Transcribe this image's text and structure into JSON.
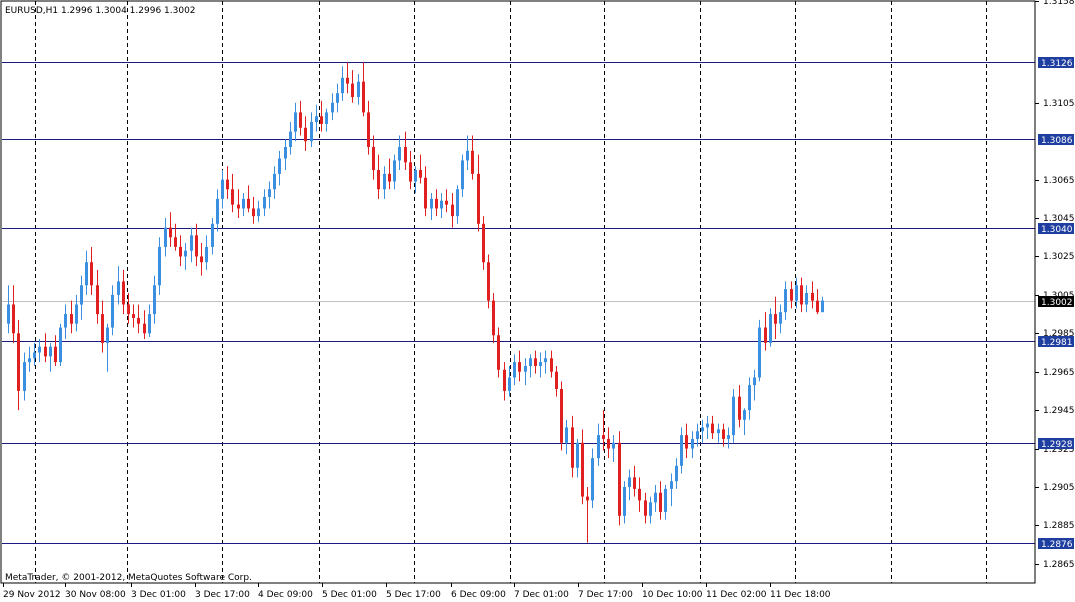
{
  "header_text": "EURUSD,H1  1.2996 1.3004 1.2996 1.3002",
  "footer_text": "MetaTrader, © 2001-2012, MetaQuotes Software Corp.",
  "colors": {
    "background": "#ffffff",
    "grid": "#000000",
    "bull_candle": "#3a8fe0",
    "bear_candle": "#e02020",
    "level_line": "#1a1a80",
    "level_label_bg": "#1f3fa0",
    "current_price_line": "#c0c0c0",
    "current_price_label_bg": "#000000"
  },
  "chart_data": {
    "type": "candlestick",
    "symbol": "EURUSD",
    "timeframe": "H1",
    "last_bar": {
      "open": 1.2996,
      "high": 1.3004,
      "low": 1.2996,
      "close": 1.3002
    },
    "ylim": [
      1.2855,
      1.3158
    ],
    "y_ticks": [
      "1.3158",
      "1.3105",
      "1.3065",
      "1.3045",
      "1.3025",
      "1.3005",
      "1.2985",
      "1.2965",
      "1.2945",
      "1.2925",
      "1.2905",
      "1.2885",
      "1.2865"
    ],
    "x_labels": [
      "29 Nov 2012",
      "30 Nov 08:00",
      "3 Dec 01:00",
      "3 Dec 17:00",
      "4 Dec 09:00",
      "5 Dec 01:00",
      "5 Dec 17:00",
      "6 Dec 09:00",
      "7 Dec 01:00",
      "7 Dec 17:00",
      "10 Dec 10:00",
      "11 Dec 02:00",
      "11 Dec 18:00"
    ],
    "vertical_separators": [
      "29 Nov 2012",
      "30 Nov 08:00",
      "3 Dec 01:00",
      "3 Dec 17:00",
      "4 Dec 09:00",
      "5 Dec 01:00",
      "5 Dec 17:00",
      "6 Dec 09:00",
      "7 Dec 01:00",
      "7 Dec 17:00",
      "10 Dec 10:00",
      "11 Dec 02:00",
      "11 Dec 18:00",
      "12 Dec 10:00"
    ],
    "levels": [
      "1.3126",
      "1.3086",
      "1.3040",
      "1.2981",
      "1.2928",
      "1.2876"
    ],
    "current_price": "1.3002",
    "candles": [
      [
        1.299,
        1.301,
        1.2985,
        1.3
      ],
      [
        1.3,
        1.301,
        1.298,
        1.2985
      ],
      [
        1.2985,
        1.2992,
        1.2945,
        1.2955
      ],
      [
        1.2955,
        1.2975,
        1.295,
        1.297
      ],
      [
        1.297,
        1.2978,
        1.2965,
        1.2972
      ],
      [
        1.2972,
        1.298,
        1.2968,
        1.2975
      ],
      [
        1.2975,
        1.2982,
        1.297,
        1.2978
      ],
      [
        1.2978,
        1.2985,
        1.297,
        1.2973
      ],
      [
        1.2973,
        1.298,
        1.2965,
        1.2978
      ],
      [
        1.2978,
        1.2984,
        1.2968,
        1.297
      ],
      [
        1.297,
        1.299,
        1.2968,
        1.2988
      ],
      [
        1.2988,
        1.3,
        1.2982,
        1.2995
      ],
      [
        1.2995,
        1.3002,
        1.2985,
        1.299
      ],
      [
        1.299,
        1.3005,
        1.2986,
        1.3
      ],
      [
        1.3,
        1.3015,
        1.2992,
        1.301
      ],
      [
        1.301,
        1.3028,
        1.3005,
        1.3022
      ],
      [
        1.3022,
        1.303,
        1.3005,
        1.301
      ],
      [
        1.301,
        1.3018,
        1.299,
        1.2995
      ],
      [
        1.2995,
        1.3002,
        1.2975,
        1.298
      ],
      [
        1.298,
        1.299,
        1.2965,
        1.2988
      ],
      [
        1.2988,
        1.301,
        1.2984,
        1.3005
      ],
      [
        1.3005,
        1.302,
        1.3,
        1.3012
      ],
      [
        1.3012,
        1.3018,
        1.2995,
        1.3
      ],
      [
        1.3,
        1.3006,
        1.299,
        1.2995
      ],
      [
        1.2995,
        1.3,
        1.2988,
        1.2993
      ],
      [
        1.2993,
        1.3,
        1.2985,
        1.299
      ],
      [
        1.299,
        1.2997,
        1.2982,
        1.2985
      ],
      [
        1.2985,
        1.3,
        1.2983,
        1.2995
      ],
      [
        1.2995,
        1.3015,
        1.299,
        1.301
      ],
      [
        1.301,
        1.3035,
        1.3005,
        1.303
      ],
      [
        1.303,
        1.3045,
        1.3025,
        1.304
      ],
      [
        1.304,
        1.3048,
        1.303,
        1.3035
      ],
      [
        1.3035,
        1.3042,
        1.3028,
        1.303
      ],
      [
        1.303,
        1.3036,
        1.302,
        1.3025
      ],
      [
        1.3025,
        1.3032,
        1.3018,
        1.3028
      ],
      [
        1.3028,
        1.304,
        1.3022,
        1.3036
      ],
      [
        1.3036,
        1.3042,
        1.302,
        1.3025
      ],
      [
        1.3025,
        1.3032,
        1.3015,
        1.3022
      ],
      [
        1.3022,
        1.3036,
        1.3018,
        1.303
      ],
      [
        1.303,
        1.3045,
        1.3026,
        1.3042
      ],
      [
        1.3042,
        1.306,
        1.3038,
        1.3055
      ],
      [
        1.3055,
        1.307,
        1.305,
        1.3065
      ],
      [
        1.3065,
        1.3072,
        1.3055,
        1.306
      ],
      [
        1.306,
        1.3068,
        1.3048,
        1.3052
      ],
      [
        1.3052,
        1.306,
        1.3045,
        1.305
      ],
      [
        1.305,
        1.3058,
        1.3046,
        1.3055
      ],
      [
        1.3055,
        1.3062,
        1.3048,
        1.305
      ],
      [
        1.305,
        1.3056,
        1.3042,
        1.3046
      ],
      [
        1.3046,
        1.3054,
        1.3043,
        1.305
      ],
      [
        1.305,
        1.306,
        1.3046,
        1.3056
      ],
      [
        1.3056,
        1.3064,
        1.305,
        1.306
      ],
      [
        1.306,
        1.3072,
        1.3055,
        1.3068
      ],
      [
        1.3068,
        1.308,
        1.3062,
        1.3076
      ],
      [
        1.3076,
        1.3086,
        1.307,
        1.3082
      ],
      [
        1.3082,
        1.3095,
        1.3078,
        1.309
      ],
      [
        1.309,
        1.3105,
        1.3085,
        1.31
      ],
      [
        1.31,
        1.3106,
        1.3088,
        1.3092
      ],
      [
        1.3092,
        1.3098,
        1.308,
        1.3085
      ],
      [
        1.3085,
        1.31,
        1.3082,
        1.3095
      ],
      [
        1.3095,
        1.3104,
        1.309,
        1.3098
      ],
      [
        1.3098,
        1.3106,
        1.309,
        1.3094
      ],
      [
        1.3094,
        1.3102,
        1.309,
        1.31
      ],
      [
        1.31,
        1.311,
        1.3096,
        1.3105
      ],
      [
        1.3105,
        1.3115,
        1.31,
        1.311
      ],
      [
        1.311,
        1.3124,
        1.3106,
        1.3118
      ],
      [
        1.3118,
        1.3126,
        1.311,
        1.3115
      ],
      [
        1.3115,
        1.3122,
        1.3105,
        1.3108
      ],
      [
        1.3108,
        1.312,
        1.3104,
        1.3116
      ],
      [
        1.3116,
        1.3126,
        1.3098,
        1.31
      ],
      [
        1.31,
        1.3106,
        1.3078,
        1.3082
      ],
      [
        1.3082,
        1.3088,
        1.3065,
        1.307
      ],
      [
        1.307,
        1.3078,
        1.3055,
        1.306
      ],
      [
        1.306,
        1.3072,
        1.3055,
        1.3068
      ],
      [
        1.3068,
        1.3076,
        1.306,
        1.3064
      ],
      [
        1.3064,
        1.3078,
        1.306,
        1.3075
      ],
      [
        1.3075,
        1.3088,
        1.307,
        1.3082
      ],
      [
        1.3082,
        1.309,
        1.307,
        1.3074
      ],
      [
        1.3074,
        1.308,
        1.306,
        1.3064
      ],
      [
        1.3064,
        1.3072,
        1.3058,
        1.307
      ],
      [
        1.307,
        1.3078,
        1.3063,
        1.3066
      ],
      [
        1.3066,
        1.3072,
        1.3046,
        1.305
      ],
      [
        1.305,
        1.3058,
        1.3044,
        1.3055
      ],
      [
        1.3055,
        1.306,
        1.3046,
        1.305
      ],
      [
        1.305,
        1.3058,
        1.3045,
        1.3054
      ],
      [
        1.3054,
        1.306,
        1.3048,
        1.3052
      ],
      [
        1.3052,
        1.3058,
        1.304,
        1.3046
      ],
      [
        1.3046,
        1.3062,
        1.3042,
        1.306
      ],
      [
        1.306,
        1.3078,
        1.3056,
        1.3075
      ],
      [
        1.3075,
        1.3088,
        1.307,
        1.308
      ],
      [
        1.308,
        1.3088,
        1.3065,
        1.3068
      ],
      [
        1.3068,
        1.3078,
        1.3038,
        1.3042
      ],
      [
        1.3042,
        1.3046,
        1.3018,
        1.3022
      ],
      [
        1.3022,
        1.3026,
        1.2998,
        1.3002
      ],
      [
        1.3002,
        1.3006,
        1.298,
        1.2984
      ],
      [
        1.2984,
        1.2988,
        1.2962,
        1.2966
      ],
      [
        1.2966,
        1.297,
        1.295,
        1.2955
      ],
      [
        1.2955,
        1.2968,
        1.2952,
        1.2962
      ],
      [
        1.2962,
        1.2974,
        1.2958,
        1.297
      ],
      [
        1.297,
        1.2976,
        1.296,
        1.2965
      ],
      [
        1.2965,
        1.2972,
        1.2958,
        1.2968
      ],
      [
        1.2968,
        1.2974,
        1.2962,
        1.2972
      ],
      [
        1.2972,
        1.2976,
        1.2964,
        1.2968
      ],
      [
        1.2968,
        1.2975,
        1.2962,
        1.297
      ],
      [
        1.297,
        1.2976,
        1.2964,
        1.2972
      ],
      [
        1.2972,
        1.2976,
        1.2962,
        1.2965
      ],
      [
        1.2965,
        1.2968,
        1.2952,
        1.2956
      ],
      [
        1.2956,
        1.296,
        1.2924,
        1.2928
      ],
      [
        1.2928,
        1.294,
        1.2922,
        1.2936
      ],
      [
        1.2936,
        1.2942,
        1.291,
        1.2915
      ],
      [
        1.2915,
        1.293,
        1.291,
        1.2928
      ],
      [
        1.2928,
        1.2935,
        1.2896,
        1.29
      ],
      [
        1.29,
        1.2905,
        1.2876,
        1.2898
      ],
      [
        1.2898,
        1.2925,
        1.2894,
        1.292
      ],
      [
        1.292,
        1.2938,
        1.2916,
        1.2932
      ],
      [
        1.2932,
        1.2945,
        1.2924,
        1.293
      ],
      [
        1.293,
        1.2936,
        1.292,
        1.2925
      ],
      [
        1.2925,
        1.2932,
        1.2918,
        1.2928
      ],
      [
        1.2928,
        1.2934,
        1.2885,
        1.289
      ],
      [
        1.289,
        1.2908,
        1.2886,
        1.2905
      ],
      [
        1.2905,
        1.2914,
        1.2898,
        1.291
      ],
      [
        1.291,
        1.2916,
        1.29,
        1.2904
      ],
      [
        1.2904,
        1.291,
        1.2892,
        1.2898
      ],
      [
        1.2898,
        1.2902,
        1.2886,
        1.289
      ],
      [
        1.289,
        1.29,
        1.2886,
        1.2897
      ],
      [
        1.2897,
        1.2906,
        1.2892,
        1.2902
      ],
      [
        1.2902,
        1.2908,
        1.2888,
        1.2892
      ],
      [
        1.2892,
        1.2906,
        1.2888,
        1.2904
      ],
      [
        1.2904,
        1.2912,
        1.2895,
        1.2908
      ],
      [
        1.2908,
        1.292,
        1.2904,
        1.2916
      ],
      [
        1.2916,
        1.2936,
        1.2912,
        1.2932
      ],
      [
        1.2932,
        1.2938,
        1.292,
        1.2925
      ],
      [
        1.2925,
        1.2934,
        1.292,
        1.293
      ],
      [
        1.293,
        1.2938,
        1.2926,
        1.2934
      ],
      [
        1.2934,
        1.294,
        1.2928,
        1.2936
      ],
      [
        1.2936,
        1.2942,
        1.293,
        1.2938
      ],
      [
        1.2938,
        1.2942,
        1.293,
        1.2933
      ],
      [
        1.2933,
        1.2938,
        1.2928,
        1.2935
      ],
      [
        1.2935,
        1.2938,
        1.2926,
        1.293
      ],
      [
        1.293,
        1.2936,
        1.2925,
        1.2932
      ],
      [
        1.2932,
        1.2956,
        1.2928,
        1.2952
      ],
      [
        1.2952,
        1.2958,
        1.2936,
        1.294
      ],
      [
        1.294,
        1.2946,
        1.2932,
        1.2945
      ],
      [
        1.2945,
        1.2962,
        1.294,
        1.2958
      ],
      [
        1.2958,
        1.2966,
        1.295,
        1.2962
      ],
      [
        1.2962,
        1.2992,
        1.296,
        1.2988
      ],
      [
        1.2988,
        1.2996,
        1.2976,
        1.298
      ],
      [
        1.298,
        1.2998,
        1.2978,
        1.2995
      ],
      [
        1.2995,
        1.3004,
        1.2982,
        1.299
      ],
      [
        1.299,
        1.3,
        1.2985,
        1.2996
      ],
      [
        1.2996,
        1.3012,
        1.2992,
        1.3008
      ],
      [
        1.3008,
        1.3012,
        1.2998,
        1.3002
      ],
      [
        1.3002,
        1.3014,
        1.2998,
        1.301
      ],
      [
        1.301,
        1.3014,
        1.2996,
        1.3
      ],
      [
        1.3,
        1.301,
        1.2996,
        1.3006
      ],
      [
        1.3006,
        1.3012,
        1.2998,
        1.3002
      ],
      [
        1.3002,
        1.3008,
        1.2995,
        1.2996
      ],
      [
        1.2996,
        1.3004,
        1.2996,
        1.3002
      ]
    ]
  }
}
